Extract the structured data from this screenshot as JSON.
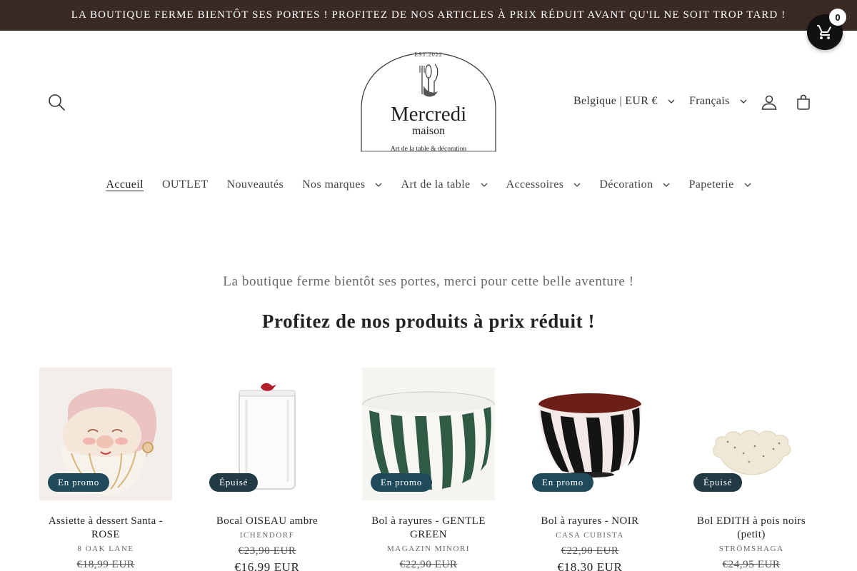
{
  "announcement": {
    "text": "LA BOUTIQUE FERME BIENTÔT SES PORTES ! PROFITEZ DE NOS ARTICLES À PRIX RÉDUIT AVANT QU'IL NE SOIT TROP TARD !"
  },
  "floating_cart": {
    "count": "0",
    "icon": "shopping-cart-icon"
  },
  "header": {
    "logo": {
      "est": "EST.2022",
      "title": "Mercredi",
      "subtitle": "maison",
      "tagline": "Art de la table & décoration"
    },
    "country": "Belgique | EUR €",
    "language": "Français",
    "icons": [
      "search-icon",
      "account-icon",
      "bag-icon"
    ]
  },
  "nav": {
    "items": [
      {
        "label": "Accueil",
        "active": true,
        "dropdown": false
      },
      {
        "label": "OUTLET",
        "active": false,
        "dropdown": false
      },
      {
        "label": "Nouveautés",
        "active": false,
        "dropdown": false
      },
      {
        "label": "Nos marques",
        "active": false,
        "dropdown": true
      },
      {
        "label": "Art de la table",
        "active": false,
        "dropdown": true
      },
      {
        "label": "Accessoires",
        "active": false,
        "dropdown": true
      },
      {
        "label": "Décoration",
        "active": false,
        "dropdown": true
      },
      {
        "label": "Papeterie",
        "active": false,
        "dropdown": true
      }
    ]
  },
  "main": {
    "intro": "La boutique ferme bientôt ses portes, merci pour cette belle aventure !",
    "heading": "Profitez de nos produits à prix réduit !"
  },
  "products": [
    {
      "title": "Assiette à dessert Santa - ROSE",
      "vendor": "8 OAK LANE",
      "badge": "En promo",
      "compare_price": "€18,99 EUR",
      "sale_price": ""
    },
    {
      "title": "Bocal OISEAU ambre",
      "vendor": "ICHENDORF",
      "badge": "Épuisé",
      "compare_price": "€23,90 EUR",
      "sale_price": "€16,99 EUR"
    },
    {
      "title": "Bol à rayures - GENTLE GREEN",
      "vendor": "MAGAZIN MINORI",
      "badge": "En promo",
      "compare_price": "€22,90 EUR",
      "sale_price": ""
    },
    {
      "title": "Bol à rayures - NOIR",
      "vendor": "CASA CUBISTA",
      "badge": "En promo",
      "compare_price": "€22,90 EUR",
      "sale_price": "€18,30 EUR"
    },
    {
      "title": "Bol EDITH à pois noirs (petit)",
      "vendor": "STRÖMSHAGA",
      "badge": "Épuisé",
      "compare_price": "€24,95 EUR",
      "sale_price": ""
    }
  ],
  "colors": {
    "announcement_bg": "#3a2a24",
    "badge_bg": "#1e4a5c",
    "text": "#222222"
  }
}
